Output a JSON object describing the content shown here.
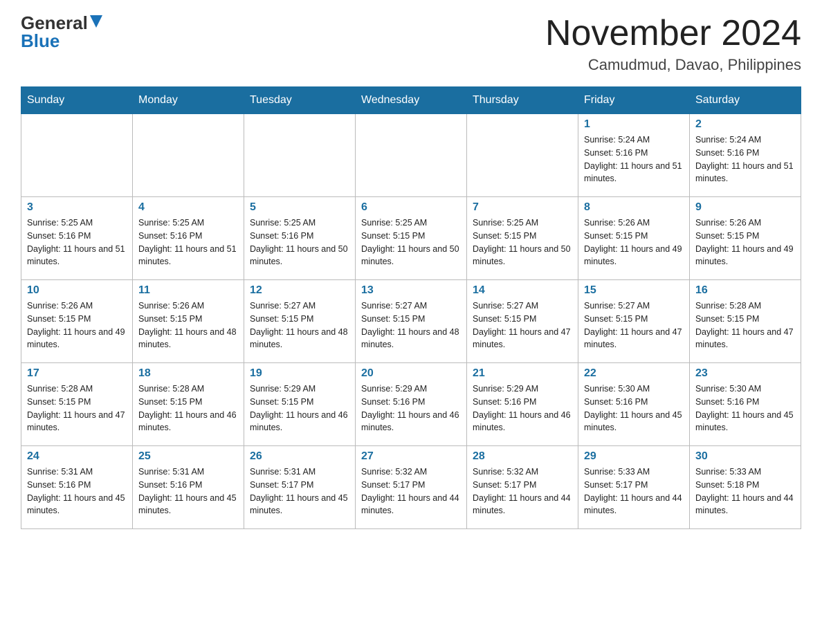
{
  "logo": {
    "general": "General",
    "arrow": "▲",
    "blue": "Blue"
  },
  "header": {
    "title": "November 2024",
    "subtitle": "Camudmud, Davao, Philippines"
  },
  "weekdays": [
    "Sunday",
    "Monday",
    "Tuesday",
    "Wednesday",
    "Thursday",
    "Friday",
    "Saturday"
  ],
  "weeks": [
    [
      {
        "day": "",
        "info": ""
      },
      {
        "day": "",
        "info": ""
      },
      {
        "day": "",
        "info": ""
      },
      {
        "day": "",
        "info": ""
      },
      {
        "day": "",
        "info": ""
      },
      {
        "day": "1",
        "info": "Sunrise: 5:24 AM\nSunset: 5:16 PM\nDaylight: 11 hours and 51 minutes."
      },
      {
        "day": "2",
        "info": "Sunrise: 5:24 AM\nSunset: 5:16 PM\nDaylight: 11 hours and 51 minutes."
      }
    ],
    [
      {
        "day": "3",
        "info": "Sunrise: 5:25 AM\nSunset: 5:16 PM\nDaylight: 11 hours and 51 minutes."
      },
      {
        "day": "4",
        "info": "Sunrise: 5:25 AM\nSunset: 5:16 PM\nDaylight: 11 hours and 51 minutes."
      },
      {
        "day": "5",
        "info": "Sunrise: 5:25 AM\nSunset: 5:16 PM\nDaylight: 11 hours and 50 minutes."
      },
      {
        "day": "6",
        "info": "Sunrise: 5:25 AM\nSunset: 5:15 PM\nDaylight: 11 hours and 50 minutes."
      },
      {
        "day": "7",
        "info": "Sunrise: 5:25 AM\nSunset: 5:15 PM\nDaylight: 11 hours and 50 minutes."
      },
      {
        "day": "8",
        "info": "Sunrise: 5:26 AM\nSunset: 5:15 PM\nDaylight: 11 hours and 49 minutes."
      },
      {
        "day": "9",
        "info": "Sunrise: 5:26 AM\nSunset: 5:15 PM\nDaylight: 11 hours and 49 minutes."
      }
    ],
    [
      {
        "day": "10",
        "info": "Sunrise: 5:26 AM\nSunset: 5:15 PM\nDaylight: 11 hours and 49 minutes."
      },
      {
        "day": "11",
        "info": "Sunrise: 5:26 AM\nSunset: 5:15 PM\nDaylight: 11 hours and 48 minutes."
      },
      {
        "day": "12",
        "info": "Sunrise: 5:27 AM\nSunset: 5:15 PM\nDaylight: 11 hours and 48 minutes."
      },
      {
        "day": "13",
        "info": "Sunrise: 5:27 AM\nSunset: 5:15 PM\nDaylight: 11 hours and 48 minutes."
      },
      {
        "day": "14",
        "info": "Sunrise: 5:27 AM\nSunset: 5:15 PM\nDaylight: 11 hours and 47 minutes."
      },
      {
        "day": "15",
        "info": "Sunrise: 5:27 AM\nSunset: 5:15 PM\nDaylight: 11 hours and 47 minutes."
      },
      {
        "day": "16",
        "info": "Sunrise: 5:28 AM\nSunset: 5:15 PM\nDaylight: 11 hours and 47 minutes."
      }
    ],
    [
      {
        "day": "17",
        "info": "Sunrise: 5:28 AM\nSunset: 5:15 PM\nDaylight: 11 hours and 47 minutes."
      },
      {
        "day": "18",
        "info": "Sunrise: 5:28 AM\nSunset: 5:15 PM\nDaylight: 11 hours and 46 minutes."
      },
      {
        "day": "19",
        "info": "Sunrise: 5:29 AM\nSunset: 5:15 PM\nDaylight: 11 hours and 46 minutes."
      },
      {
        "day": "20",
        "info": "Sunrise: 5:29 AM\nSunset: 5:16 PM\nDaylight: 11 hours and 46 minutes."
      },
      {
        "day": "21",
        "info": "Sunrise: 5:29 AM\nSunset: 5:16 PM\nDaylight: 11 hours and 46 minutes."
      },
      {
        "day": "22",
        "info": "Sunrise: 5:30 AM\nSunset: 5:16 PM\nDaylight: 11 hours and 45 minutes."
      },
      {
        "day": "23",
        "info": "Sunrise: 5:30 AM\nSunset: 5:16 PM\nDaylight: 11 hours and 45 minutes."
      }
    ],
    [
      {
        "day": "24",
        "info": "Sunrise: 5:31 AM\nSunset: 5:16 PM\nDaylight: 11 hours and 45 minutes."
      },
      {
        "day": "25",
        "info": "Sunrise: 5:31 AM\nSunset: 5:16 PM\nDaylight: 11 hours and 45 minutes."
      },
      {
        "day": "26",
        "info": "Sunrise: 5:31 AM\nSunset: 5:17 PM\nDaylight: 11 hours and 45 minutes."
      },
      {
        "day": "27",
        "info": "Sunrise: 5:32 AM\nSunset: 5:17 PM\nDaylight: 11 hours and 44 minutes."
      },
      {
        "day": "28",
        "info": "Sunrise: 5:32 AM\nSunset: 5:17 PM\nDaylight: 11 hours and 44 minutes."
      },
      {
        "day": "29",
        "info": "Sunrise: 5:33 AM\nSunset: 5:17 PM\nDaylight: 11 hours and 44 minutes."
      },
      {
        "day": "30",
        "info": "Sunrise: 5:33 AM\nSunset: 5:18 PM\nDaylight: 11 hours and 44 minutes."
      }
    ]
  ]
}
